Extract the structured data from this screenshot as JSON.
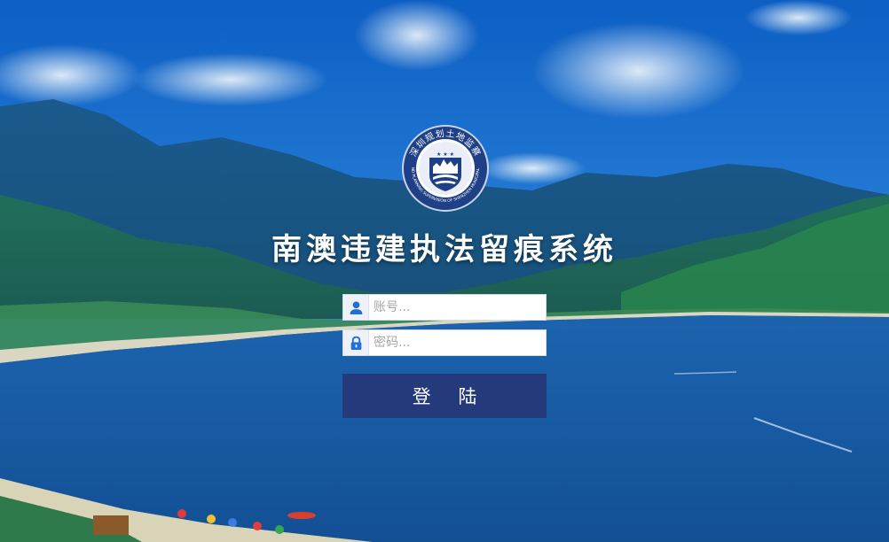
{
  "page": {
    "title": "南澳违建执法留痕系统"
  },
  "emblem": {
    "icon": "police-badge-icon",
    "text_top": "深圳规划土地监察",
    "text_bottom": "LAND PLANNING SUPERVISION OF SHENZHEN MUNICIPALITY"
  },
  "login": {
    "account_placeholder": "账号...",
    "account_value": "",
    "account_icon": "user-icon",
    "password_placeholder": "密码...",
    "password_value": "",
    "password_icon": "lock-icon",
    "submit_label": "登 陆"
  },
  "colors": {
    "button": "#243a7a",
    "icon": "#1e6fd9",
    "title": "#ffffff"
  }
}
